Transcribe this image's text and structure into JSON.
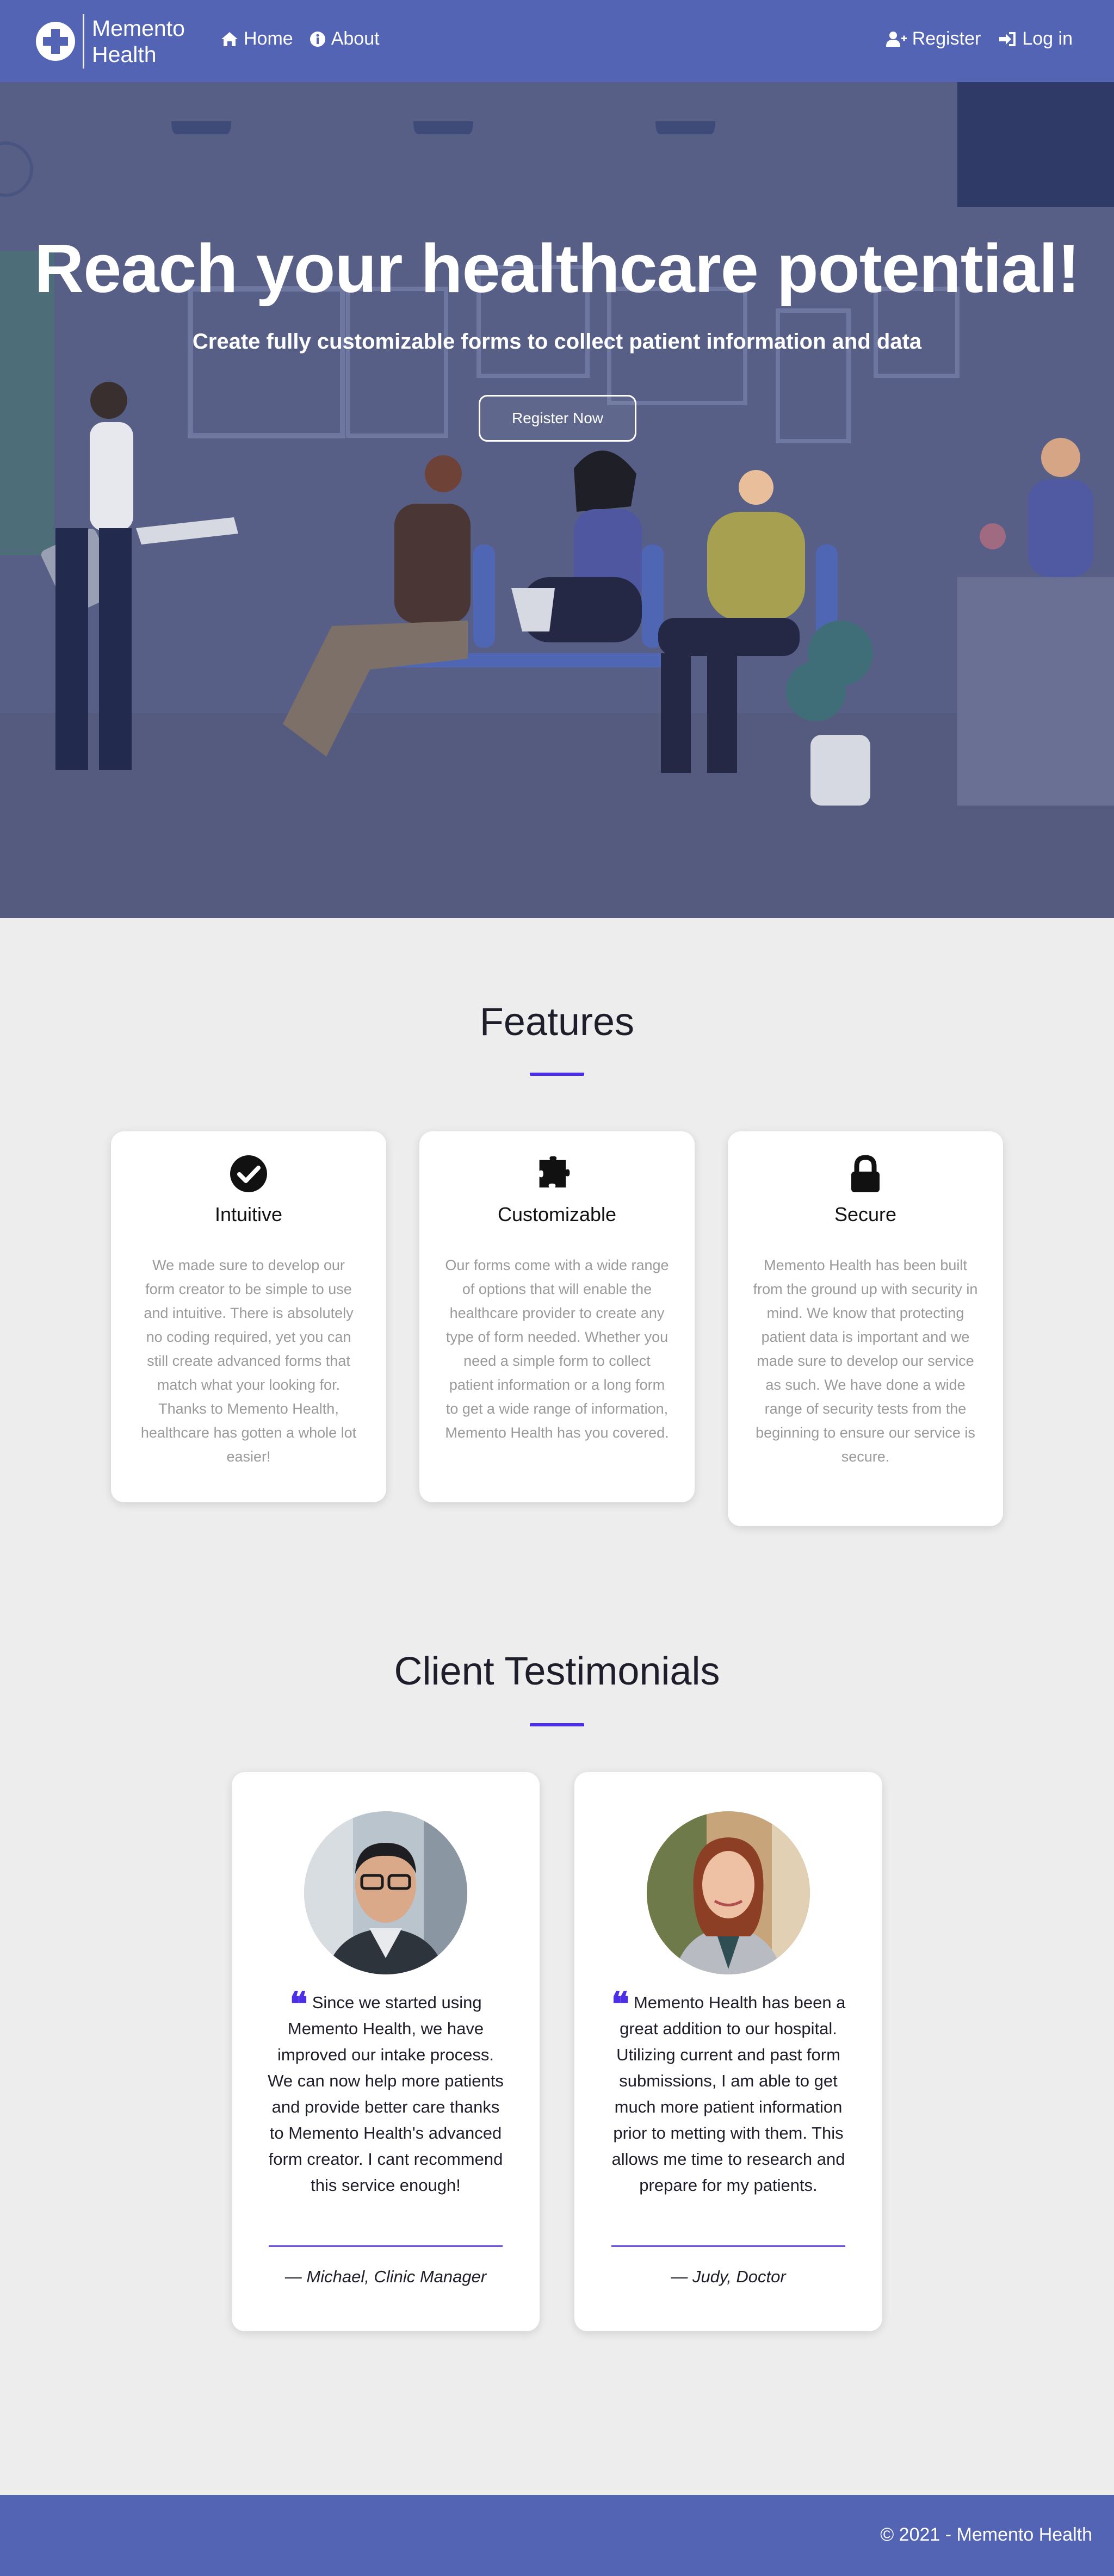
{
  "nav": {
    "brand": "Memento\nHealth",
    "links_left": [
      {
        "label": "Home",
        "icon": "home-icon"
      },
      {
        "label": "About",
        "icon": "info-icon"
      }
    ],
    "links_right": [
      {
        "label": "Register",
        "icon": "user-plus-icon"
      },
      {
        "label": "Log in",
        "icon": "sign-in-icon"
      }
    ]
  },
  "hero": {
    "title": "Reach your healthcare potential!",
    "subtitle": "Create fully customizable forms to collect patient information and data",
    "button": "Register Now"
  },
  "features": {
    "title": "Features",
    "cards": [
      {
        "icon": "check-circle-icon",
        "name": "Intuitive",
        "text": "We made sure to develop our form creator to be simple to use and intuitive. There is absolutely no coding required, yet you can still create advanced forms that match what your looking for. Thanks to Memento Health, healthcare has gotten a whole lot easier!"
      },
      {
        "icon": "puzzle-piece-icon",
        "name": "Customizable",
        "text": "Our forms come with a wide range of options that will enable the healthcare provider to create any type of form needed. Whether you need a simple form to collect patient information or a long form to get a wide range of information, Memento Health has you covered."
      },
      {
        "icon": "lock-icon",
        "name": "Secure",
        "text": "Memento Health has been built from the ground up with security in mind. We know that protecting patient data is important and we made sure to develop our service as such. We have done a wide range of security tests from the beginning to ensure our service is secure."
      }
    ]
  },
  "testimonials": {
    "title": "Client Testimonials",
    "items": [
      {
        "quote": "Since we started using Memento Health, we have improved our intake process. We can now help more patients and provide better care thanks to Memento Health's advanced form creator. I cant recommend this service enough!",
        "author": "— Michael, Clinic Manager"
      },
      {
        "quote": "Memento Health has been a great addition to our hospital. Utilizing current and past form submissions, I am able to get much more patient information prior to metting with them. This allows me time to research and prepare for my patients.",
        "author": "— Judy, Doctor"
      }
    ]
  },
  "footer": {
    "text": "© 2021 - Memento Health"
  },
  "colors": {
    "primary": "#5464b4",
    "accent": "#4c2ee6",
    "hero_overlay": "#585f86"
  }
}
